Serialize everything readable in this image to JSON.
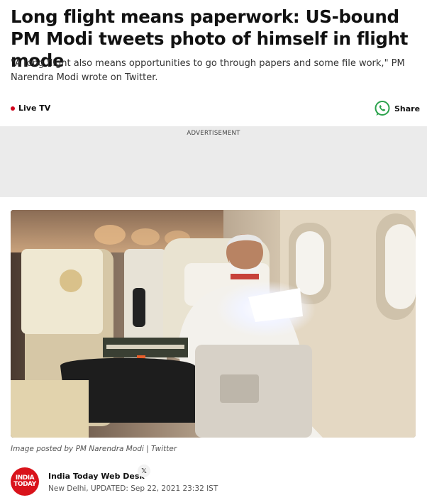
{
  "article": {
    "headline": "Long flight means paperwork: US-bound PM Modi tweets photo of himself in flight mode",
    "summary": "\"A long flight also means opportunities to go through papers and some file work,\" PM Narendra Modi wrote on Twitter."
  },
  "toolbar": {
    "live_label": "Live TV",
    "share_label": "Share",
    "share_icon": "whatsapp-icon",
    "live_dot_color": "#d0021b",
    "share_icon_color": "#2ba24c"
  },
  "ad": {
    "label": "ADVERTISEMENT"
  },
  "photo": {
    "caption": "Image posted by PM Narendra Modi | Twitter"
  },
  "author": {
    "logo_line1": "INDIA",
    "logo_line2": "TODAY",
    "logo_color": "#d9131b",
    "name": "India Today Web Desk",
    "social_icon": "x-icon",
    "social_glyph": "𝕏",
    "location": "New Delhi,",
    "updated": "UPDATED: Sep 22, 2021 23:32 IST"
  }
}
